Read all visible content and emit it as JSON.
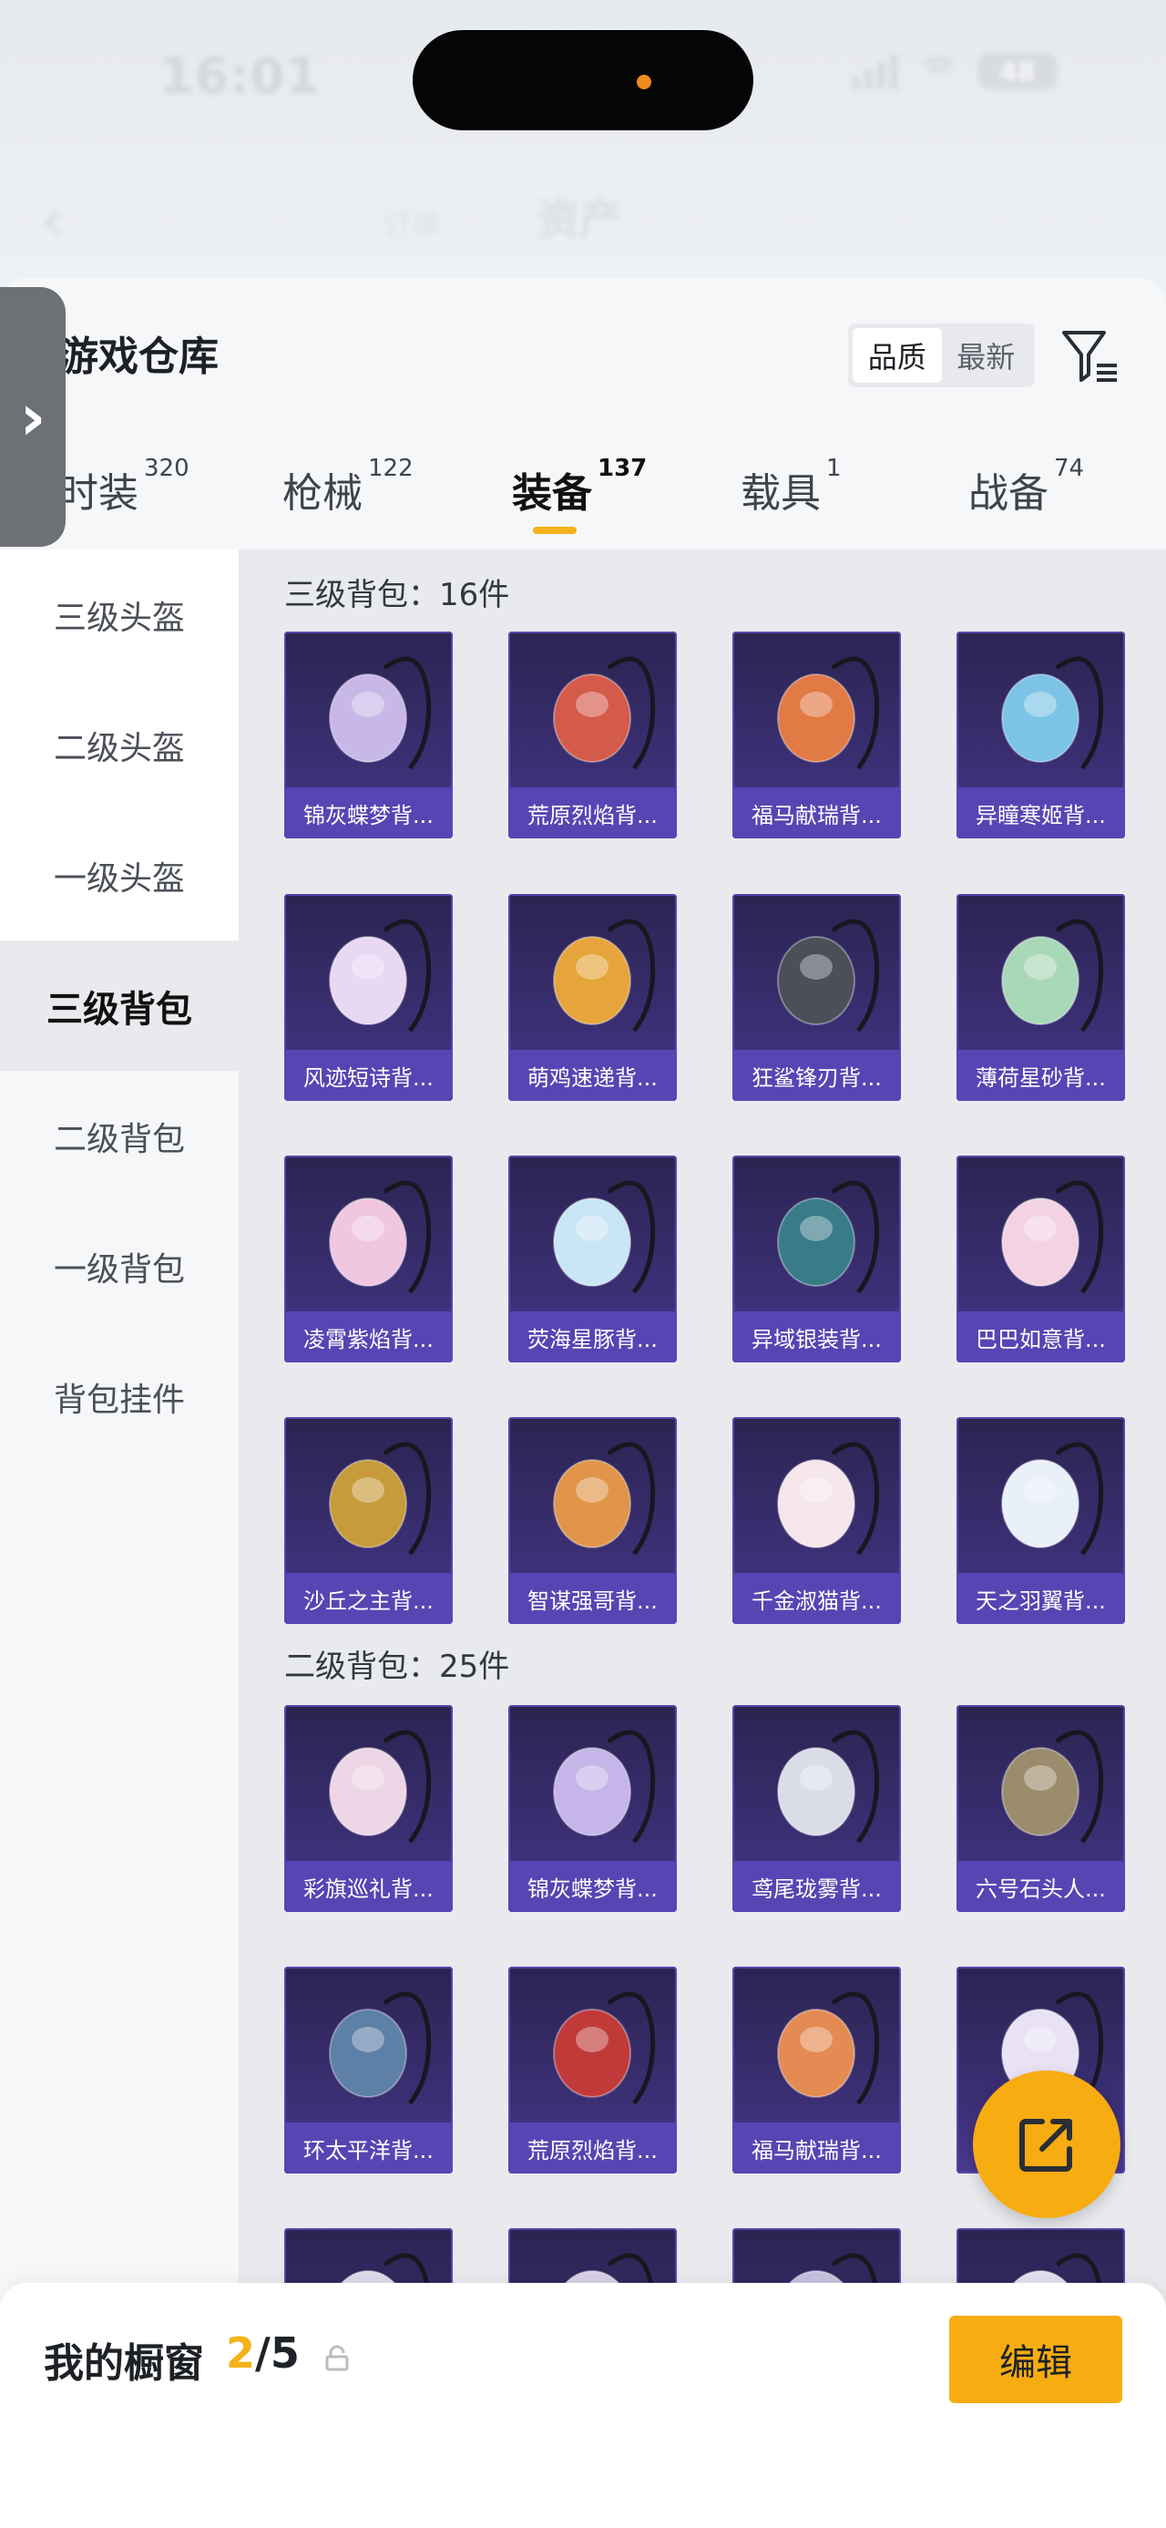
{
  "status_bar": {
    "time": "16:01",
    "battery": "48"
  },
  "nav": {
    "back": "‹",
    "title": "资产",
    "sub": "订单"
  },
  "warehouse": {
    "title": "游戏仓库",
    "sort": [
      "品质",
      "最新"
    ]
  },
  "tabs": [
    {
      "label": "时装",
      "count": "320"
    },
    {
      "label": "枪械",
      "count": "122"
    },
    {
      "label": "装备",
      "count": "137"
    },
    {
      "label": "载具",
      "count": "1"
    },
    {
      "label": "战备",
      "count": "74"
    }
  ],
  "sidebar": [
    "三级头盔",
    "二级头盔",
    "一级头盔",
    "三级背包",
    "二级背包",
    "一级背包",
    "背包挂件"
  ],
  "sections": [
    {
      "label": "三级背包：16件"
    },
    {
      "label": "二级背包：25件"
    }
  ],
  "items": [
    "锦灰蝶梦背...",
    "荒原烈焰背...",
    "福马献瑞背...",
    "异瞳寒姬背...",
    "风迹短诗背...",
    "萌鸡速递背...",
    "狂鲨锋刃背...",
    "薄荷星砂背...",
    "凌霄紫焰背...",
    "荧海星豚背...",
    "异域银装背...",
    "巴巴如意背...",
    "沙丘之主背...",
    "智谋强哥背...",
    "千金淑猫背...",
    "天之羽翼背...",
    "彩旗巡礼背...",
    "锦灰蝶梦背...",
    "鸢尾珑雾背...",
    "六号石头人...",
    "环太平洋背...",
    "荒原烈焰背...",
    "福马献瑞背..."
  ],
  "showcase": {
    "label": "我的橱窗",
    "current": "2",
    "total": "/5",
    "edit": "编辑"
  },
  "colors": {
    "accent": "#f5b21a",
    "item_bg": "#3b2f74",
    "item_label_bg": "#5845b3"
  }
}
